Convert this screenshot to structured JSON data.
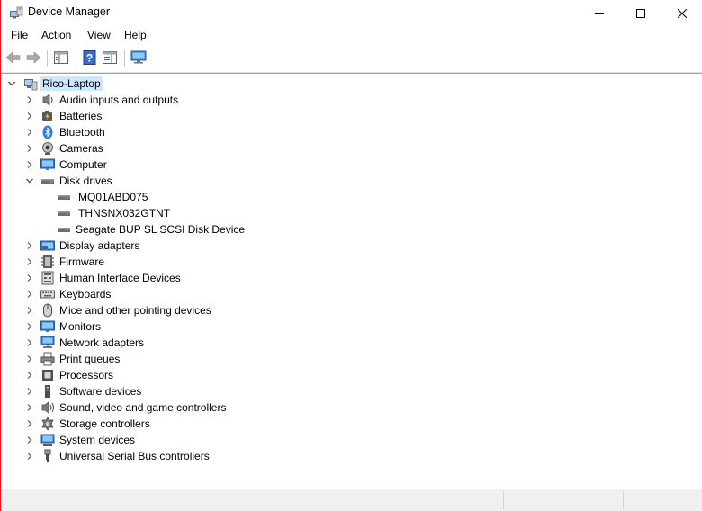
{
  "window": {
    "title": "Device Manager",
    "accent": "#e81123",
    "selection_color": "#cce8ff",
    "icons": {
      "app": "device-manager-icon",
      "minimize": "minimize-icon",
      "maximize": "maximize-icon",
      "close": "close-icon"
    }
  },
  "menu": {
    "items": [
      "File",
      "Action",
      "View",
      "Help"
    ]
  },
  "toolbar": {
    "buttons": [
      "back-arrow-icon",
      "forward-arrow-icon",
      "show-hide-console-tree-icon",
      "help-icon",
      "properties-pane-icon",
      "scan-hardware-monitor-icon"
    ]
  },
  "tree": {
    "root": {
      "label": "Rico-Laptop",
      "expanded": true,
      "selected": true,
      "icon": "computer-icon"
    },
    "categories": [
      {
        "label": "Audio inputs and outputs",
        "icon": "speaker-icon",
        "expanded": false
      },
      {
        "label": "Batteries",
        "icon": "battery-icon",
        "expanded": false
      },
      {
        "label": "Bluetooth",
        "icon": "bluetooth-icon",
        "expanded": false
      },
      {
        "label": "Cameras",
        "icon": "camera-icon",
        "expanded": false
      },
      {
        "label": "Computer",
        "icon": "monitor-icon",
        "expanded": false
      },
      {
        "label": "Disk drives",
        "icon": "disk-drive-icon",
        "expanded": true,
        "children": [
          {
            "label": "MQ01ABD075",
            "icon": "disk-drive-icon"
          },
          {
            "label": "THNSNX032GTNT",
            "icon": "disk-drive-icon"
          },
          {
            "label": "Seagate BUP SL SCSI Disk Device",
            "icon": "disk-drive-icon"
          }
        ]
      },
      {
        "label": "Display adapters",
        "icon": "display-adapter-icon",
        "expanded": false
      },
      {
        "label": "Firmware",
        "icon": "firmware-icon",
        "expanded": false
      },
      {
        "label": "Human Interface Devices",
        "icon": "hid-icon",
        "expanded": false
      },
      {
        "label": "Keyboards",
        "icon": "keyboard-icon",
        "expanded": false
      },
      {
        "label": "Mice and other pointing devices",
        "icon": "mouse-icon",
        "expanded": false
      },
      {
        "label": "Monitors",
        "icon": "monitor-icon",
        "expanded": false
      },
      {
        "label": "Network adapters",
        "icon": "network-adapter-icon",
        "expanded": false
      },
      {
        "label": "Print queues",
        "icon": "printer-icon",
        "expanded": false
      },
      {
        "label": "Processors",
        "icon": "processor-icon",
        "expanded": false
      },
      {
        "label": "Software devices",
        "icon": "software-device-icon",
        "expanded": false
      },
      {
        "label": "Sound, video and game controllers",
        "icon": "sound-icon",
        "expanded": false
      },
      {
        "label": "Storage controllers",
        "icon": "storage-controller-icon",
        "expanded": false
      },
      {
        "label": "System devices",
        "icon": "system-device-icon",
        "expanded": false
      },
      {
        "label": "Universal Serial Bus controllers",
        "icon": "usb-icon",
        "expanded": false
      }
    ]
  }
}
